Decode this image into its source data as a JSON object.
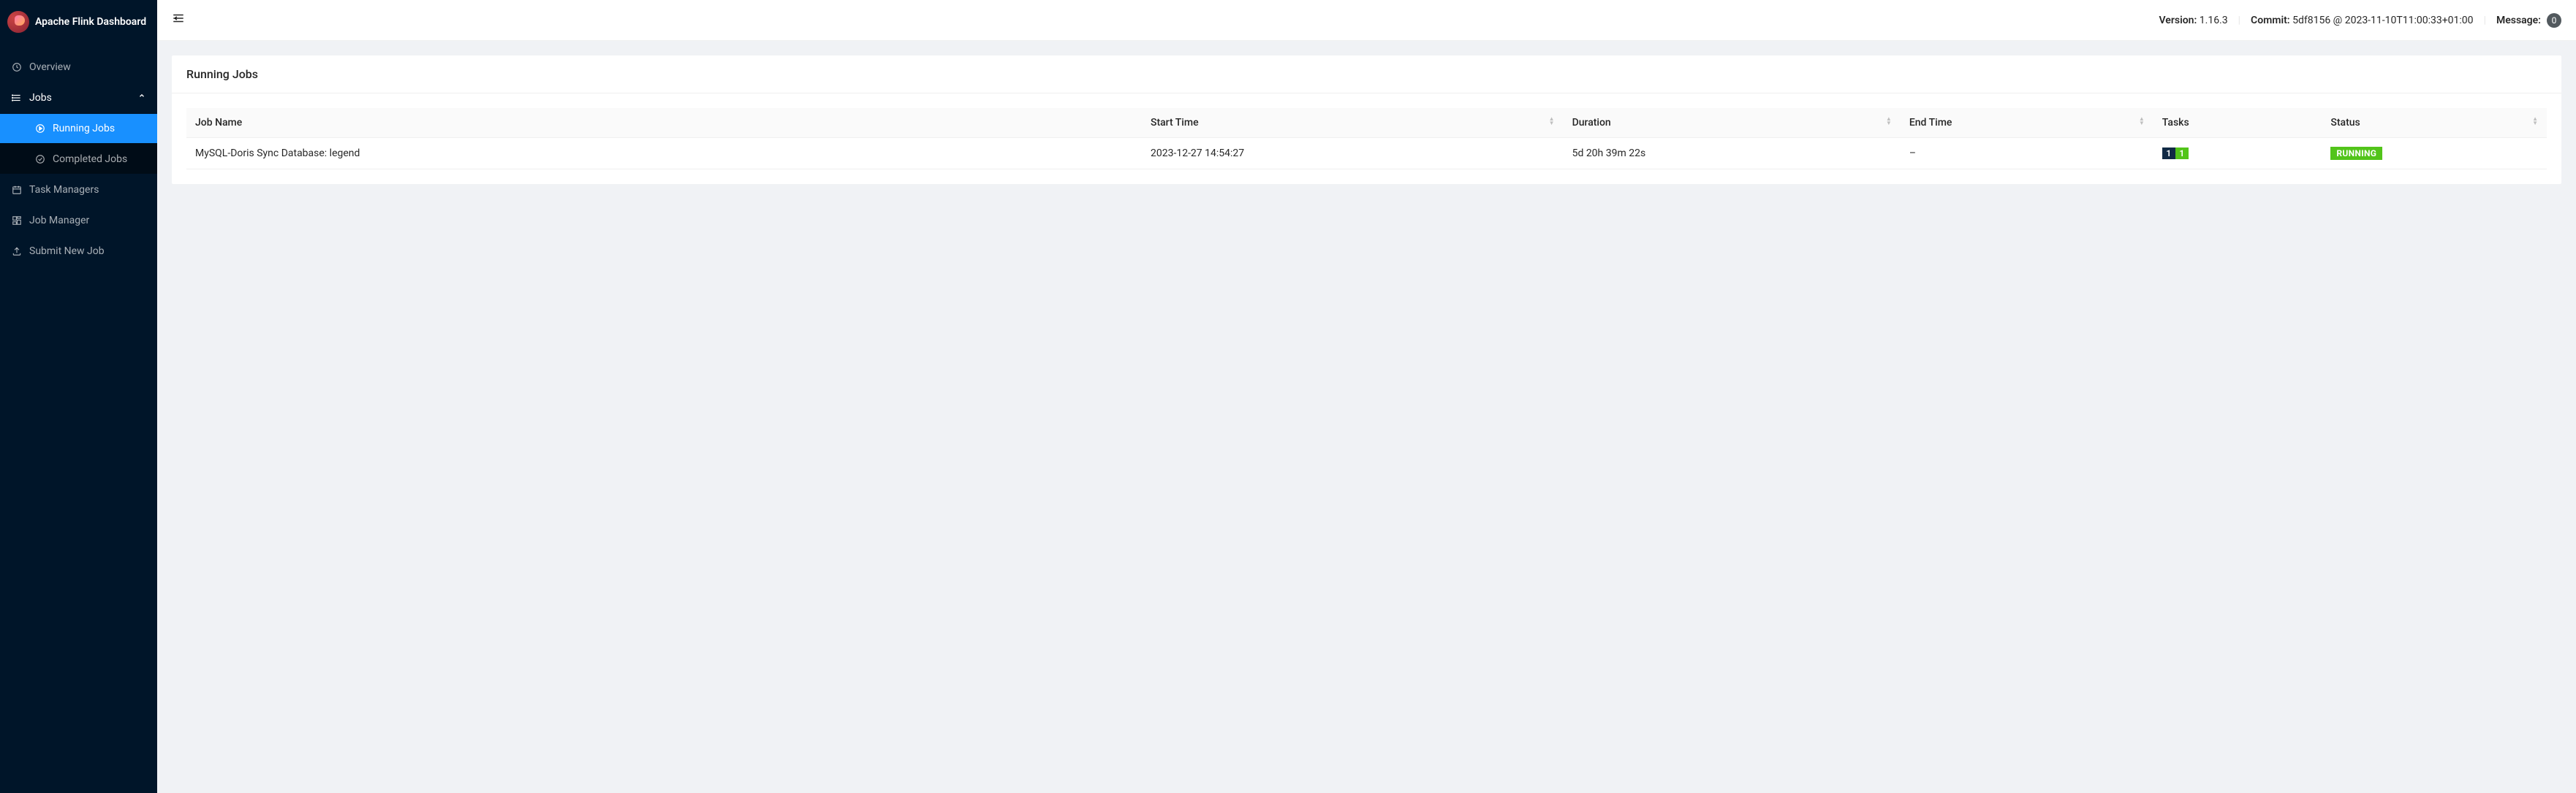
{
  "app": {
    "title": "Apache Flink Dashboard"
  },
  "sidebar": {
    "items": [
      {
        "label": "Overview"
      },
      {
        "label": "Jobs"
      },
      {
        "label": "Running Jobs"
      },
      {
        "label": "Completed Jobs"
      },
      {
        "label": "Task Managers"
      },
      {
        "label": "Job Manager"
      },
      {
        "label": "Submit New Job"
      }
    ]
  },
  "topbar": {
    "version_label": "Version:",
    "version_value": "1.16.3",
    "commit_label": "Commit:",
    "commit_value": "5df8156 @ 2023-11-10T11:00:33+01:00",
    "message_label": "Message:",
    "message_count": "0"
  },
  "page": {
    "title": "Running Jobs"
  },
  "table": {
    "headers": {
      "job_name": "Job Name",
      "start_time": "Start Time",
      "duration": "Duration",
      "end_time": "End Time",
      "tasks": "Tasks",
      "status": "Status"
    },
    "rows": [
      {
        "job_name": "MySQL-Doris Sync Database: legend",
        "start_time": "2023-12-27 14:54:27",
        "duration": "5d 20h 39m 22s",
        "end_time": "–",
        "tasks_total": "1",
        "tasks_running": "1",
        "status": "RUNNING"
      }
    ]
  }
}
